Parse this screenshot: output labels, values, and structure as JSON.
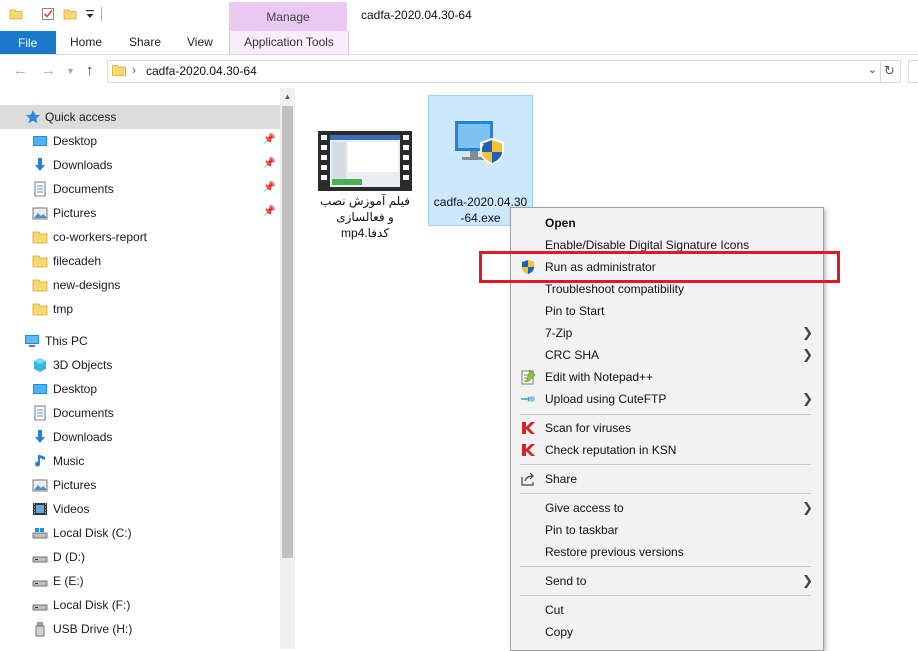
{
  "window": {
    "title": "cadfa-2020.04.30-64",
    "manage_label": "Manage"
  },
  "ribbon": {
    "file": "File",
    "home": "Home",
    "share": "Share",
    "view": "View",
    "app_tools": "Application Tools"
  },
  "address": {
    "path": "cadfa-2020.04.30-64"
  },
  "nav": {
    "quick_access": "Quick access",
    "qa_items": [
      {
        "label": "Desktop",
        "icon": "desktop-icon",
        "pinned": true
      },
      {
        "label": "Downloads",
        "icon": "downloads-icon",
        "pinned": true
      },
      {
        "label": "Documents",
        "icon": "documents-icon",
        "pinned": true
      },
      {
        "label": "Pictures",
        "icon": "pictures-icon",
        "pinned": true
      },
      {
        "label": "co-workers-report",
        "icon": "folder-icon",
        "pinned": false
      },
      {
        "label": "filecadeh",
        "icon": "folder-icon",
        "pinned": false
      },
      {
        "label": "new-designs",
        "icon": "folder-icon",
        "pinned": false
      },
      {
        "label": "tmp",
        "icon": "folder-icon",
        "pinned": false
      }
    ],
    "this_pc": "This PC",
    "pc_items": [
      {
        "label": "3D Objects",
        "icon": "3d-objects-icon"
      },
      {
        "label": "Desktop",
        "icon": "desktop-icon"
      },
      {
        "label": "Documents",
        "icon": "documents-icon"
      },
      {
        "label": "Downloads",
        "icon": "downloads-icon"
      },
      {
        "label": "Music",
        "icon": "music-icon"
      },
      {
        "label": "Pictures",
        "icon": "pictures-icon"
      },
      {
        "label": "Videos",
        "icon": "videos-icon"
      },
      {
        "label": "Local Disk (C:)",
        "icon": "drive-c-icon"
      },
      {
        "label": "D (D:)",
        "icon": "drive-icon"
      },
      {
        "label": "E (E:)",
        "icon": "drive-icon"
      },
      {
        "label": "Local Disk (F:)",
        "icon": "drive-icon"
      },
      {
        "label": "USB Drive (H:)",
        "icon": "usb-drive-icon"
      }
    ]
  },
  "files": [
    {
      "name_line1": "فیلم آموزش نصب",
      "name_line2": "و فعالسازی",
      "name_line3": "کدفا.mp4",
      "icon": "video-file-icon"
    },
    {
      "name_line1": "cadfa-2020.04.30",
      "name_line2": "-64.exe",
      "icon": "setup-exe-icon",
      "selected": true
    }
  ],
  "context_menu": {
    "items": [
      {
        "label": "Open",
        "bold": true
      },
      {
        "label": "Enable/Disable Digital Signature Icons"
      },
      {
        "label": "Run as administrator",
        "icon": "uac-shield-icon"
      },
      {
        "label": "Troubleshoot compatibility"
      },
      {
        "label": "Pin to Start"
      },
      {
        "label": "7-Zip",
        "submenu": true
      },
      {
        "label": "CRC SHA",
        "submenu": true
      },
      {
        "label": "Edit with Notepad++",
        "icon": "notepad-plus-plus-icon"
      },
      {
        "label": "Upload using CuteFTP",
        "icon": "cuteftp-icon",
        "submenu": true
      },
      {
        "label": "Scan for viruses",
        "icon": "kaspersky-icon"
      },
      {
        "label": "Check reputation in KSN",
        "icon": "kaspersky-icon"
      },
      {
        "label": "Share",
        "icon": "share-icon"
      },
      {
        "label": "Give access to",
        "submenu": true
      },
      {
        "label": "Pin to taskbar"
      },
      {
        "label": "Restore previous versions"
      },
      {
        "label": "Send to",
        "submenu": true
      },
      {
        "label": "Cut"
      },
      {
        "label": "Copy"
      }
    ]
  },
  "colors": {
    "file_tab": "#1979ca",
    "manage_tab": "#e9c8f2",
    "selection": "#cce8ff",
    "highlight_box": "#e0182a"
  }
}
